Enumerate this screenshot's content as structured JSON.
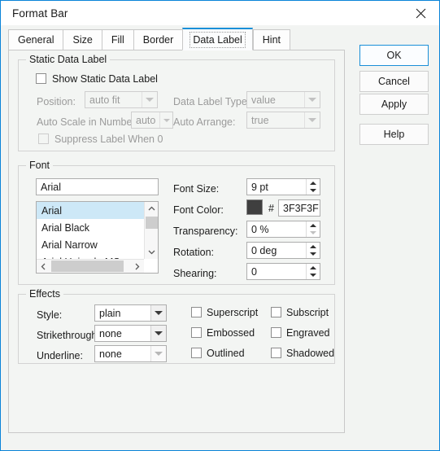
{
  "window": {
    "title": "Format Bar",
    "close_icon": "close-icon"
  },
  "tabs": [
    {
      "label": "General",
      "active": false
    },
    {
      "label": "Size",
      "active": false
    },
    {
      "label": "Fill",
      "active": false
    },
    {
      "label": "Border",
      "active": false
    },
    {
      "label": "Data Label",
      "active": true
    },
    {
      "label": "Hint",
      "active": false
    }
  ],
  "static_data_label": {
    "group_label": "Static Data Label",
    "show_checkbox": {
      "label": "Show Static Data Label",
      "checked": false
    },
    "position": {
      "label": "Position:",
      "value": "auto fit"
    },
    "data_label_type": {
      "label": "Data Label Type:",
      "value": "value"
    },
    "auto_scale": {
      "label": "Auto Scale in Number:",
      "value": "auto"
    },
    "auto_arrange": {
      "label": "Auto Arrange:",
      "value": "true"
    },
    "suppress": {
      "label": "Suppress Label When 0",
      "checked": false
    }
  },
  "font": {
    "group_label": "Font",
    "name_field": "Arial",
    "list": [
      "Arial",
      "Arial Black",
      "Arial Narrow",
      "Arial Unicode MS"
    ],
    "selected": "Arial",
    "font_size": {
      "label": "Font Size:",
      "value": "9 pt"
    },
    "font_color": {
      "label": "Font Color:",
      "hash": "#",
      "value": "3F3F3F",
      "swatch": "#3F3F3F"
    },
    "transparency": {
      "label": "Transparency:",
      "value": "0 %"
    },
    "rotation": {
      "label": "Rotation:",
      "value": "0 deg"
    },
    "shearing": {
      "label": "Shearing:",
      "value": "0"
    }
  },
  "effects": {
    "group_label": "Effects",
    "style": {
      "label": "Style:",
      "value": "plain"
    },
    "strikethrough": {
      "label": "Strikethrough:",
      "value": "none"
    },
    "underline": {
      "label": "Underline:",
      "value": "none"
    },
    "checkboxes": [
      {
        "label": "Superscript",
        "checked": false
      },
      {
        "label": "Subscript",
        "checked": false
      },
      {
        "label": "Embossed",
        "checked": false
      },
      {
        "label": "Engraved",
        "checked": false
      },
      {
        "label": "Outlined",
        "checked": false
      },
      {
        "label": "Shadowed",
        "checked": false
      }
    ]
  },
  "buttons": {
    "ok": "OK",
    "cancel": "Cancel",
    "apply": "Apply",
    "help": "Help"
  },
  "colors": {
    "accent": "#1A8FD8",
    "dialog_bg": "#F3F5F3",
    "selection": "#CDE8F7"
  }
}
